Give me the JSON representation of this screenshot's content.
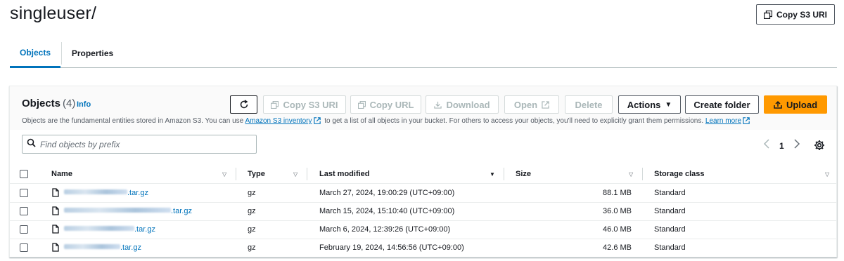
{
  "page": {
    "title": "singleuser/",
    "copy_s3_uri": "Copy S3 URI"
  },
  "tabs": [
    {
      "label": "Objects",
      "active": true
    },
    {
      "label": "Properties",
      "active": false
    }
  ],
  "panel": {
    "title": "Objects",
    "count": "(4)",
    "info": "Info",
    "description_pre": "Objects are the fundamental entities stored in Amazon S3. You can use ",
    "inventory_link": "Amazon S3 inventory",
    "description_mid": " to get a list of all objects in your bucket. For others to access your objects, you'll need to explicitly grant them permissions. ",
    "learn_more": "Learn more",
    "search_placeholder": "Find objects by prefix",
    "page_number": "1"
  },
  "toolbar": {
    "refresh": "refresh-icon",
    "copy_s3_uri": "Copy S3 URI",
    "copy_url": "Copy URL",
    "download": "Download",
    "open": "Open",
    "delete": "Delete",
    "actions": "Actions",
    "create_folder": "Create folder",
    "upload": "Upload"
  },
  "columns": {
    "name": "Name",
    "type": "Type",
    "last_modified": "Last modified",
    "size": "Size",
    "storage_class": "Storage class"
  },
  "rows": [
    {
      "name_suffix": ".tar.gz",
      "type": "gz",
      "last_modified": "March 27, 2024, 19:00:29 (UTC+09:00)",
      "size": "88.1 MB",
      "storage_class": "Standard"
    },
    {
      "name_suffix": ".tar.gz",
      "type": "gz",
      "last_modified": "March 15, 2024, 15:10:40 (UTC+09:00)",
      "size": "36.0 MB",
      "storage_class": "Standard"
    },
    {
      "name_suffix": ".tar.gz",
      "type": "gz",
      "last_modified": "March 6, 2024, 12:39:26 (UTC+09:00)",
      "size": "46.0 MB",
      "storage_class": "Standard"
    },
    {
      "name_suffix": ".tar.gz",
      "type": "gz",
      "last_modified": "February 19, 2024, 14:56:56 (UTC+09:00)",
      "size": "42.6 MB",
      "storage_class": "Standard"
    }
  ],
  "colors": {
    "link": "#0073bb",
    "upload": "#ff9900",
    "text": "#16191f"
  }
}
